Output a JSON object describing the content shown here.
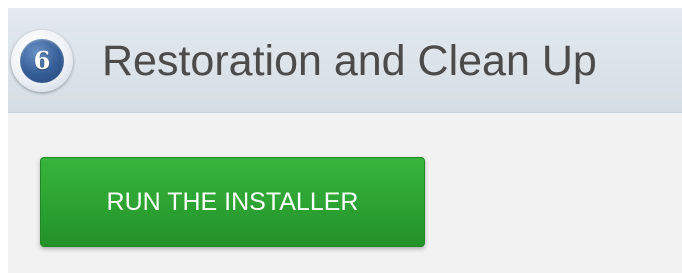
{
  "step": {
    "number": "6",
    "title": "Restoration and Clean Up"
  },
  "actions": {
    "run_installer_label": "RUN THE INSTALLER"
  },
  "colors": {
    "header_background": "#dbe2e8",
    "panel_background": "#f2f2f2",
    "badge_blue": "#355d95",
    "button_green": "#2ca232",
    "title_text": "#4b4b4b"
  }
}
